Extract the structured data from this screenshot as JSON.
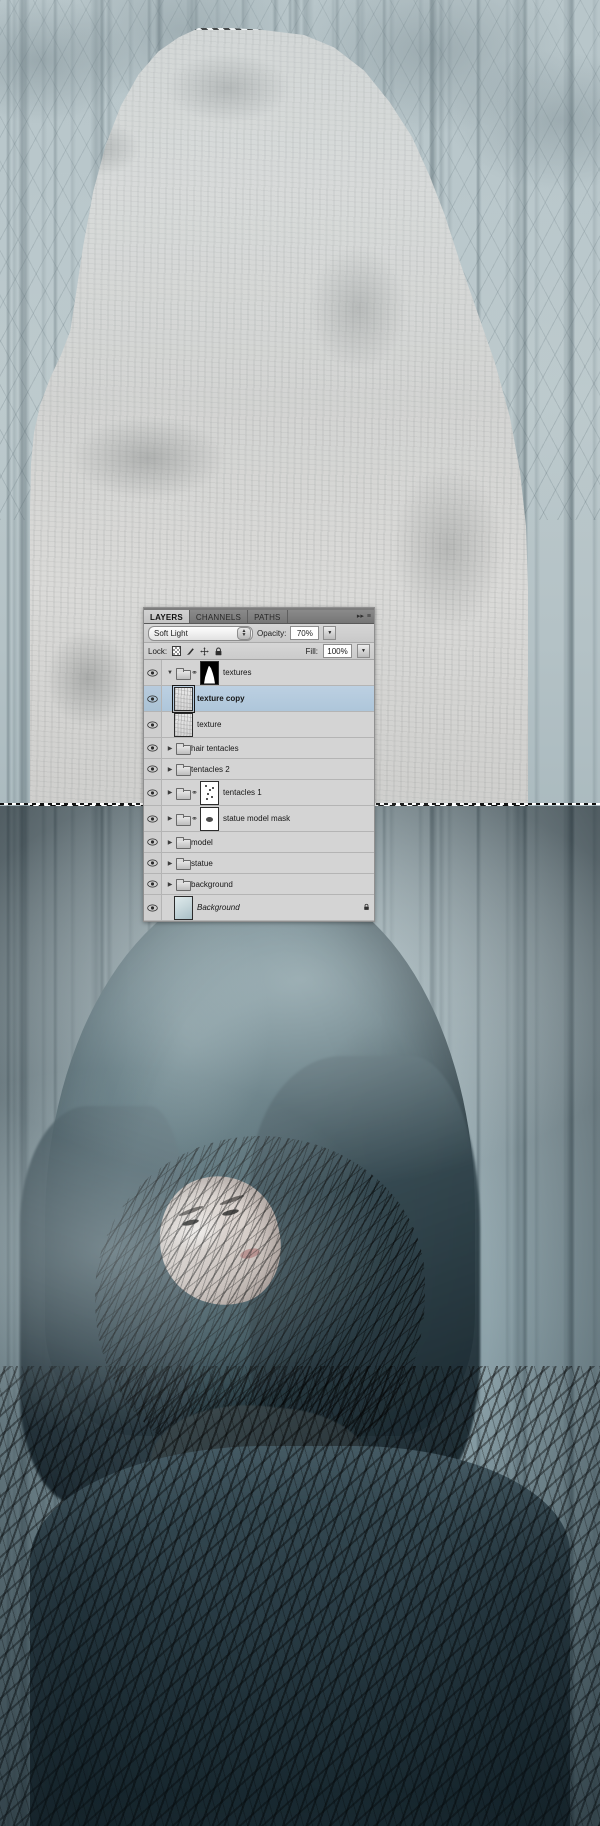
{
  "app": {
    "panel_title": "Layers Panel",
    "artwork_description": "Dark misty forest composite with hooded statue figure"
  },
  "panel": {
    "tabs": [
      {
        "label": "LAYERS",
        "active": true
      },
      {
        "label": "CHANNELS",
        "active": false
      },
      {
        "label": "PATHS",
        "active": false
      }
    ],
    "tab_icons": [
      {
        "name": "collapse-icon",
        "glyph": "▸▸"
      },
      {
        "name": "panel-menu-icon",
        "glyph": "≡"
      }
    ],
    "blend_row": {
      "blend_mode": "Soft Light",
      "opacity_label": "Opacity:",
      "opacity_value": "70%"
    },
    "lock_row": {
      "lock_label": "Lock:",
      "lock_icons": [
        {
          "name": "lock-transparent-pixels-icon",
          "glyph": ""
        },
        {
          "name": "lock-image-pixels-icon",
          "glyph": "✐"
        },
        {
          "name": "lock-position-icon",
          "glyph": "✥"
        },
        {
          "name": "lock-all-icon",
          "glyph": "ὑ2"
        }
      ],
      "fill_label": "Fill:",
      "fill_value": "100%"
    },
    "layers": [
      {
        "name": "textures",
        "type": "group",
        "visible": true,
        "expanded": true,
        "selected": false,
        "italic": false,
        "bold": false,
        "has_disclosure": true,
        "has_folder": true,
        "has_link": true,
        "thumb": "mask-mountain",
        "locked": false,
        "indent": 0
      },
      {
        "name": "texture copy",
        "type": "layer",
        "visible": true,
        "expanded": false,
        "selected": true,
        "italic": false,
        "bold": true,
        "has_disclosure": false,
        "has_folder": false,
        "has_link": false,
        "thumb": "texture",
        "locked": false,
        "indent": 1
      },
      {
        "name": "texture",
        "type": "layer",
        "visible": true,
        "expanded": false,
        "selected": false,
        "italic": false,
        "bold": false,
        "has_disclosure": false,
        "has_folder": false,
        "has_link": false,
        "thumb": "texture",
        "locked": false,
        "indent": 1
      },
      {
        "name": "hair tentacles",
        "type": "group",
        "visible": true,
        "expanded": false,
        "selected": false,
        "italic": false,
        "bold": false,
        "has_disclosure": true,
        "has_folder": true,
        "has_link": false,
        "thumb": "none",
        "locked": false,
        "indent": 0
      },
      {
        "name": "tentacles 2",
        "type": "group",
        "visible": true,
        "expanded": false,
        "selected": false,
        "italic": false,
        "bold": false,
        "has_disclosure": true,
        "has_folder": true,
        "has_link": false,
        "thumb": "none",
        "locked": false,
        "indent": 0
      },
      {
        "name": "tentacles 1",
        "type": "group",
        "visible": true,
        "expanded": false,
        "selected": false,
        "italic": false,
        "bold": false,
        "has_disclosure": true,
        "has_folder": true,
        "has_link": true,
        "thumb": "specks",
        "locked": false,
        "indent": 0
      },
      {
        "name": "statue model mask",
        "type": "group",
        "visible": true,
        "expanded": false,
        "selected": false,
        "italic": false,
        "bold": false,
        "has_disclosure": true,
        "has_folder": true,
        "has_link": true,
        "thumb": "blob",
        "locked": false,
        "indent": 0
      },
      {
        "name": "model",
        "type": "group",
        "visible": true,
        "expanded": false,
        "selected": false,
        "italic": false,
        "bold": false,
        "has_disclosure": true,
        "has_folder": true,
        "has_link": false,
        "thumb": "none",
        "locked": false,
        "indent": 0
      },
      {
        "name": "statue",
        "type": "group",
        "visible": true,
        "expanded": false,
        "selected": false,
        "italic": false,
        "bold": false,
        "has_disclosure": true,
        "has_folder": true,
        "has_link": false,
        "thumb": "none",
        "locked": false,
        "indent": 0
      },
      {
        "name": "background",
        "type": "group",
        "visible": true,
        "expanded": false,
        "selected": false,
        "italic": false,
        "bold": false,
        "has_disclosure": true,
        "has_folder": true,
        "has_link": false,
        "thumb": "none",
        "locked": false,
        "indent": 0
      },
      {
        "name": "Background",
        "type": "layer",
        "visible": true,
        "expanded": false,
        "selected": false,
        "italic": true,
        "bold": false,
        "has_disclosure": false,
        "has_folder": false,
        "has_link": false,
        "thumb": "photo",
        "locked": true,
        "indent": 1
      }
    ]
  },
  "colors": {
    "panel_bg": "#d4d4d4",
    "selected_row": "#b5cbdd",
    "tab_active": "#cdcdcd",
    "tab_inactive": "#808080",
    "border": "#8f8f8f",
    "text": "#161616"
  }
}
